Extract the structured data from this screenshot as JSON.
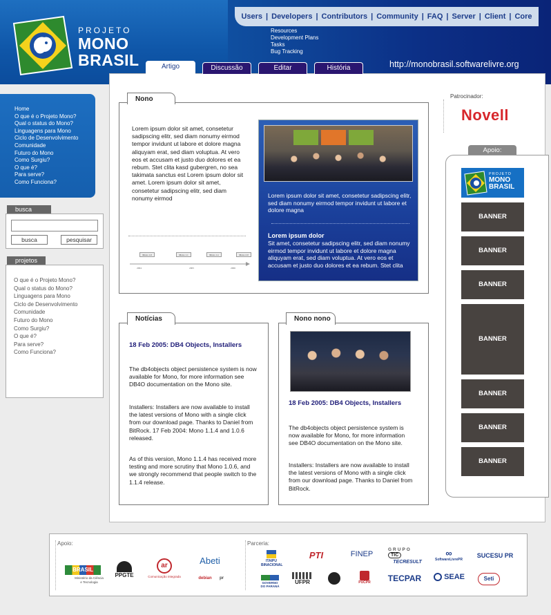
{
  "header": {
    "top_nav": [
      "Users",
      "Developers",
      "Contributors",
      "Community",
      "FAQ",
      "Server",
      "Client",
      "Core"
    ],
    "submenu": [
      "Resources",
      "Development Plans",
      "Tasks",
      "Bug Tracking"
    ],
    "logo": {
      "line1": "PROJETO",
      "line2": "MONO",
      "line3": "BRASIL"
    },
    "url": "http://monobrasil.softwarelivre.org",
    "tabs": [
      "Artigo",
      "Discussão",
      "Editar",
      "História"
    ]
  },
  "left_menu": {
    "items": [
      "Home",
      "O que é o Projeto Mono?",
      "Qual o status do Mono?",
      "Linguagens para Mono",
      "Ciclo de Desenvolvimento",
      "Comunidade",
      "Futuro do Mono",
      "Como Surgiu?",
      "O que é?",
      "Para serve?",
      "Como Funciona?"
    ]
  },
  "search": {
    "label": "busca",
    "input_value": "",
    "button_search": "busca",
    "button_go": "pesquisar"
  },
  "projetos": {
    "label": "projetos",
    "items": [
      "O que é o Projeto Mono?",
      "Qual o status do Mono?",
      "Linguagens para Mono",
      "Ciclo de Desenvolvimento",
      "Comunidade",
      "Futuro do Mono",
      "Como Surgiu?",
      "O que é?",
      "Para serve?",
      "Como Funciona?"
    ]
  },
  "nono": {
    "title": "Nono",
    "body": "Lorem ipsum dolor sit amet, consetetur sadipscing elitr, sed diam nonumy eirmod tempor invidunt ut labore et dolore magna aliquyam erat, sed diam voluptua. At vero eos et accusam et justo duo dolores et ea rebum. Stet clita kasd gubergren, no sea takimata sanctus est Lorem ipsum dolor sit amet. Lorem ipsum dolor sit amet, consetetur sadipscing elitr, sed diam nonumy eirmod",
    "timeline": {
      "marks": [
        "Mono 1.0",
        "Mono 1.1",
        "Mono 1.x",
        "Mono 2.0"
      ],
      "years": [
        "2004",
        "2005",
        "2006"
      ]
    },
    "feature": {
      "caption": "Lorem ipsum dolor sit amet, consetetur sadipscing elitr, sed diam nonumy eirmod tempor invidunt ut labore et dolore magna",
      "heading": "Lorem ipsum dolor",
      "body": "Sit amet, consetetur sadipscing elitr, sed diam nonumy eirmod tempor invidunt ut labore et dolore magna aliquyam erat, sed diam voluptua. At vero eos et accusam et justo duo dolores et ea rebum. Stet clita"
    }
  },
  "noticias": {
    "title": "Notícias",
    "headline": "18 Feb 2005: DB4 Objects, Installers",
    "p1": "The db4objects object persistence system is now available for Mono, for more information see DB4O documentation on the Mono site.",
    "p2": "Installers: Installers are now available to install the latest versions of Mono with a single click from our download page. Thanks to Daniel from BitRock. 17 Feb 2004: Mono 1.1.4 and 1.0.6 released.",
    "p3": "As of this version, Mono 1.1.4 has received more testing and more scrutiny that Mono 1.0.6, and we strongly recommend that people switch to the 1.1.4 release."
  },
  "nono_nono": {
    "title": "Nono nono",
    "headline": "18 Feb 2005: DB4 Objects, Installers",
    "p1": "The db4objects object persistence system is now available for Mono, for more information see DB4O documentation on the Mono site.",
    "p2": "Installers: Installers are now available to install the latest versions of Mono with a single click from our download page. Thanks to Daniel from BitRock."
  },
  "sponsor": {
    "label": "Patrocinador:",
    "name": "Novell",
    "apoio_label": "Apoio:",
    "apoio_logo": {
      "line1": "PROJETO",
      "line2": "MONO",
      "line3": "BRASIL"
    },
    "banners": [
      "BANNER",
      "BANNER",
      "BANNER",
      "BANNER",
      "BANNER",
      "BANNER",
      "BANNER"
    ]
  },
  "footer": {
    "apoio_label": "Apoio:",
    "parceria_label": "Parceria:",
    "apoio_logos": [
      "BRASIL",
      "Ministério da Ciência e Tecnologia",
      "PPGTE",
      "ar",
      "Comunicação integrada",
      "Abeti",
      "debian",
      "pr"
    ],
    "parceria_logos": [
      "ITAIPU BINACIONAL",
      "PTI",
      "FINEP",
      "GRUPO",
      "TIC",
      "TECRESULT",
      "SoftwareLivrePR",
      "SUCESU PR",
      "GOVERNO DO PARANÁ",
      "UFPR",
      "PUCPR",
      "TECPAR",
      "SEAE",
      "Seti"
    ]
  },
  "colors": {
    "header_blue": "#1263b4",
    "nav_dark": "#0c2f86",
    "tab_purple": "#2a1670",
    "headline_navy": "#22207a",
    "banner_gray": "#484340",
    "novell_red": "#d7262b"
  }
}
